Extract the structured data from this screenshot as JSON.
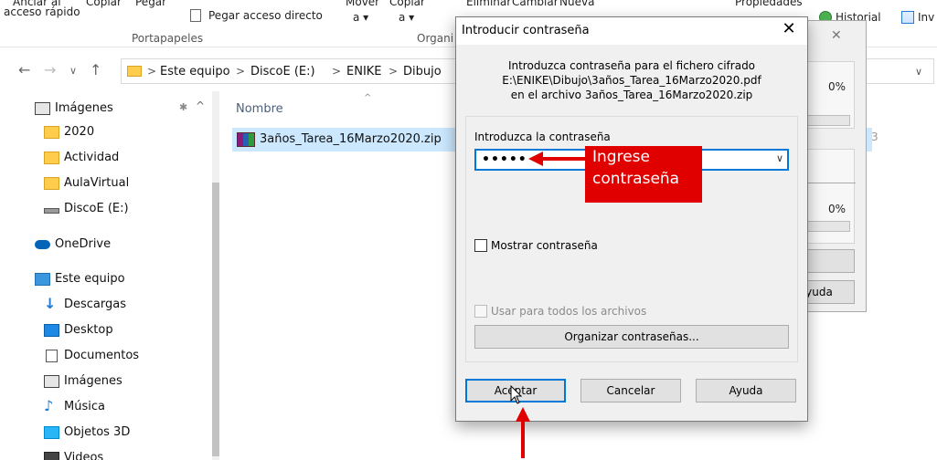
{
  "ribbon": {
    "pin_label_1": "Anclar al",
    "pin_label_2": "acceso rápido",
    "copy_label": "Copiar",
    "paste_label": "Pegar",
    "paste_shortcut_label": "Pegar acceso directo",
    "move_label": "Mover",
    "move_to": "a ▾",
    "copy_to": "a ▾",
    "copy2_label": "Copiar",
    "delete_label": "Eliminar",
    "rename_label": "Cambiar",
    "new_label": "Nueva",
    "properties_label": "Propiedades",
    "history_label": "Historial",
    "invert_label": "Inv",
    "group_clipboard": "Portapapeles",
    "group_organize": "Organi"
  },
  "address": {
    "crumbs": [
      "Este equipo",
      "DiscoE (E:)",
      "ENIKE",
      "Dibujo"
    ],
    "back_glyph": "←",
    "forward_glyph": "→",
    "recent_glyph": "∨",
    "up_glyph": "↑",
    "sep": ">",
    "dropdown_glyph": "∨"
  },
  "nav": {
    "items": [
      {
        "label": "Imágenes",
        "icon": "pictures-icon"
      },
      {
        "label": "2020",
        "icon": "folder-icon"
      },
      {
        "label": "Actividad",
        "icon": "folder-icon"
      },
      {
        "label": "AulaVirtual",
        "icon": "folder-icon"
      },
      {
        "label": "DiscoE (E:)",
        "icon": "drive-icon"
      },
      {
        "label": "OneDrive",
        "icon": "cloud-icon"
      },
      {
        "label": "Este equipo",
        "icon": "computer-icon"
      },
      {
        "label": "Descargas",
        "icon": "download-icon"
      },
      {
        "label": "Desktop",
        "icon": "desktop-icon"
      },
      {
        "label": "Documentos",
        "icon": "documents-icon"
      },
      {
        "label": "Imágenes",
        "icon": "pictures-icon"
      },
      {
        "label": "Música",
        "icon": "music-icon"
      },
      {
        "label": "Objetos 3D",
        "icon": "3d-objects-icon"
      },
      {
        "label": "Videos",
        "icon": "videos-icon"
      }
    ]
  },
  "filelist": {
    "column_name": "Nombre",
    "sort_glyph": "^",
    "files": [
      {
        "name": "3años_Tarea_16Marzo2020.zip",
        "icon": "winrar-archive-icon"
      }
    ]
  },
  "bgwindow": {
    "percent_1": "0%",
    "percent_2": "0%",
    "help_fragment": "yuda",
    "close_glyph": "✕",
    "digit": "3"
  },
  "dialog": {
    "title": "Introducir contraseña",
    "close_glyph": "✕",
    "message_line1": "Introduzca contraseña para el fichero cifrado",
    "message_line2": "E:\\ENIKE\\Dibujo\\3años_Tarea_16Marzo2020.pdf",
    "message_line3": "en el archivo 3años_Tarea_16Marzo2020.zip",
    "password_label": "Introduzca la contraseña",
    "password_value": "•••••",
    "dropdown_glyph": "∨",
    "show_password_label": "Mostrar contraseña",
    "use_for_all_label": "Usar para todos los archivos",
    "organize_button": "Organizar contraseñas...",
    "ok_button": "Aceptar",
    "cancel_button": "Cancelar",
    "help_button": "Ayuda"
  },
  "annotation": {
    "line1": "Ingrese",
    "line2": "contraseña"
  },
  "colors": {
    "accent": "#0078d7",
    "annotation_red": "#e00000",
    "selected_row": "#cce8ff",
    "dialog_bg": "#f0f0f0"
  }
}
